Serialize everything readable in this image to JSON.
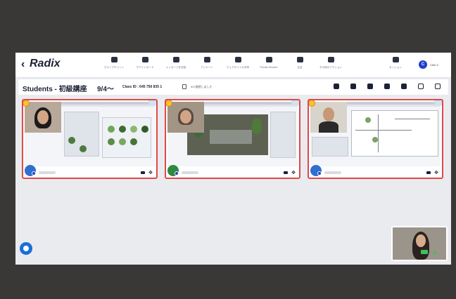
{
  "app": {
    "logo": "Radix",
    "back_glyph": "‹"
  },
  "toolbar": {
    "items": [
      {
        "icon": "group-chat-icon",
        "label": "グループチャット"
      },
      {
        "icon": "whiteboard-icon",
        "label": "ホワイトボード"
      },
      {
        "icon": "message-icon",
        "label": "メッセージを送信"
      },
      {
        "icon": "survey-icon",
        "label": "アンケート"
      },
      {
        "icon": "web-share-icon",
        "label": "ウェブサイトの共有"
      },
      {
        "icon": "private-session-icon",
        "label": "Private Session"
      },
      {
        "icon": "attention-icon",
        "label": "注目"
      },
      {
        "icon": "more-icon",
        "label": "その他のアクション"
      }
    ],
    "session": {
      "icon": "session-icon",
      "label": "セッション"
    }
  },
  "user": {
    "initial": "C",
    "name": "CAD 3"
  },
  "class_bar": {
    "title": "Students - 初級講座",
    "date": "9/4〜",
    "class_id": "Class ID : 645 756 835 1",
    "connected": "3/3 接続しました"
  },
  "room_tools": [
    {
      "icon": "group-icon"
    },
    {
      "icon": "hand-icon"
    },
    {
      "icon": "mic-icon"
    },
    {
      "icon": "camera-icon"
    },
    {
      "icon": "hide-icon"
    },
    {
      "icon": "frame-icon"
    },
    {
      "icon": "layout-icon"
    }
  ],
  "colors": {
    "accent": "#1b6fd8",
    "tile_border": "#e04848",
    "brand": "#1c2236"
  }
}
